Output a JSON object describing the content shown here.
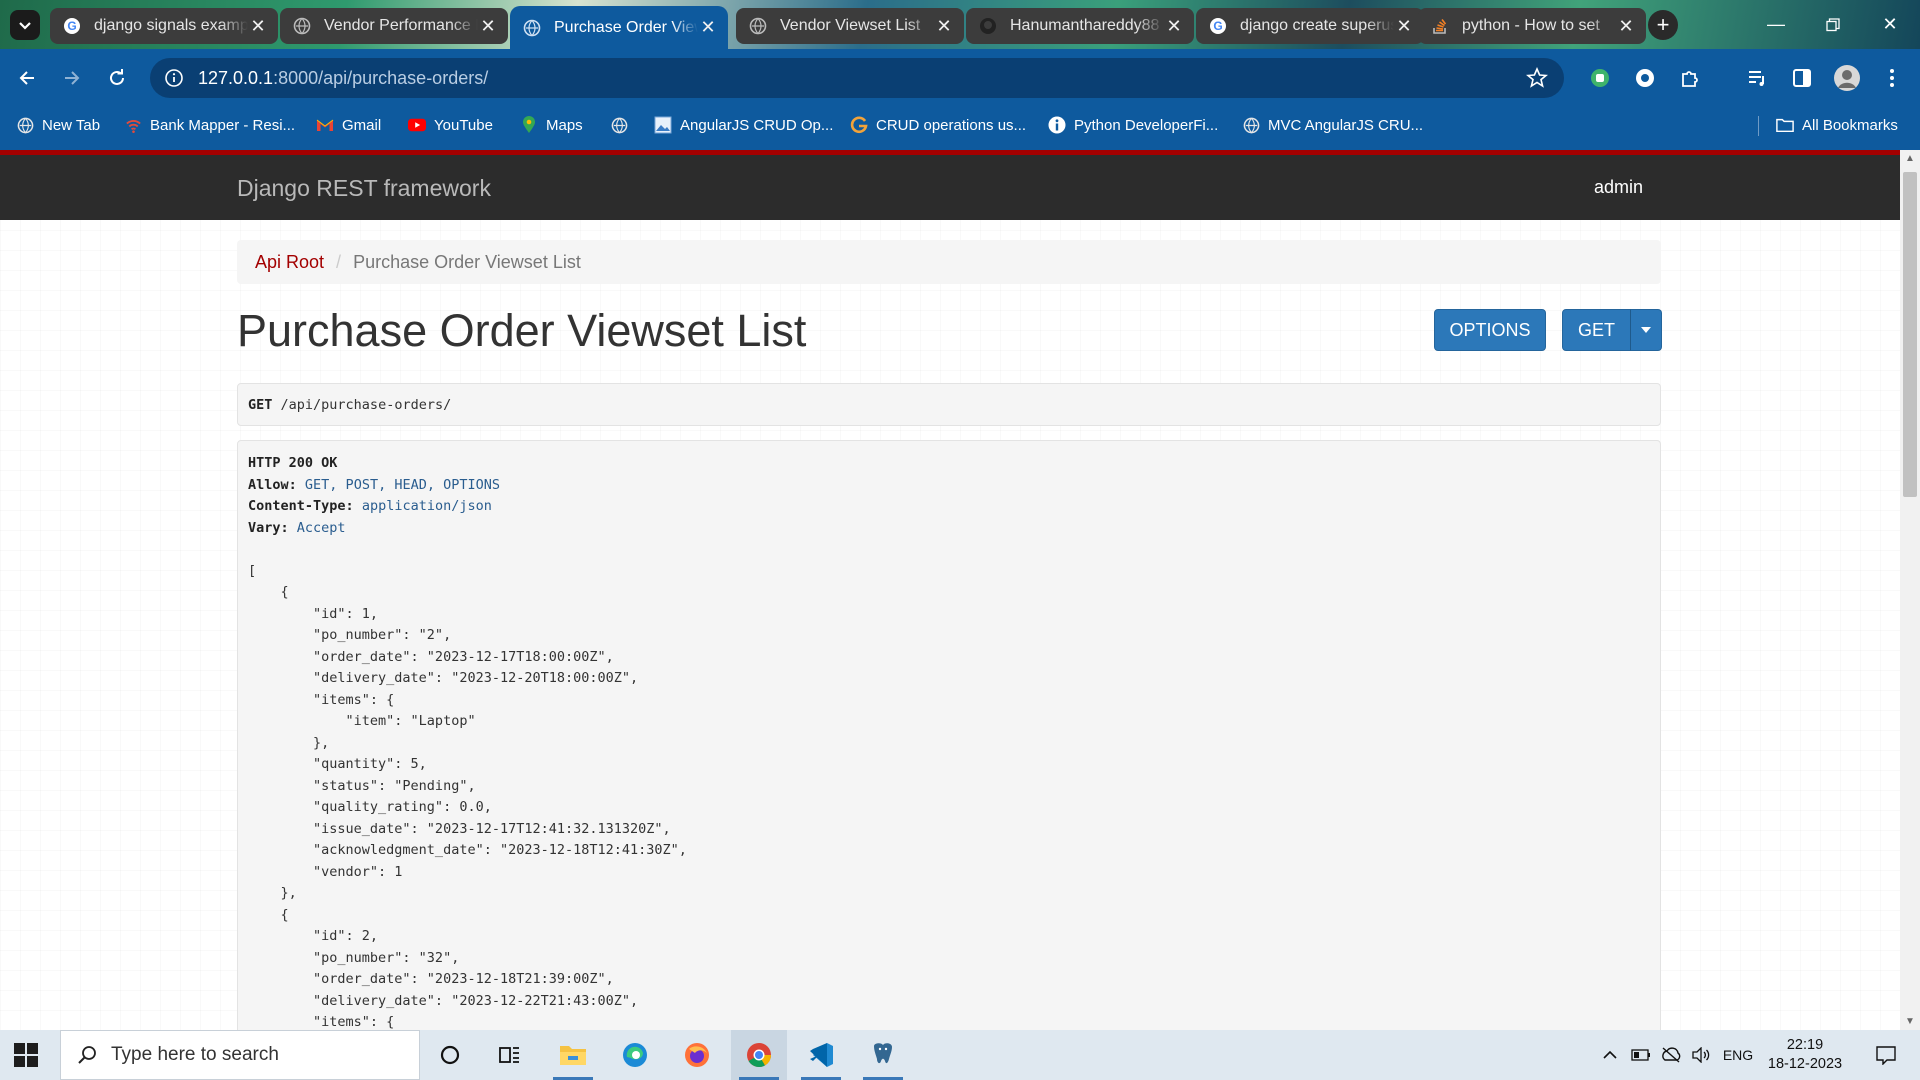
{
  "browser": {
    "tabs": [
      {
        "title": "django signals example",
        "icon": "google-icon",
        "active": false
      },
      {
        "title": "Vendor Performance Metrics",
        "icon": "globe-icon",
        "active": false
      },
      {
        "title": "Purchase Order Viewset List",
        "icon": "globe-icon",
        "active": true
      },
      {
        "title": "Vendor Viewset List",
        "icon": "globe-icon",
        "active": false
      },
      {
        "title": "Hanumanthareddy88",
        "icon": "github-icon",
        "active": false
      },
      {
        "title": "django create superuser",
        "icon": "google-icon",
        "active": false
      },
      {
        "title": "python - How to set",
        "icon": "stackoverflow-icon",
        "active": false
      }
    ],
    "url": {
      "host": "127.0.0.1",
      "path": ":8000/api/purchase-orders/"
    },
    "bookmarks": [
      {
        "label": "New Tab",
        "icon": "globe-icon"
      },
      {
        "label": "Bank Mapper - Resi...",
        "icon": "wifi-icon"
      },
      {
        "label": "Gmail",
        "icon": "gmail-icon"
      },
      {
        "label": "YouTube",
        "icon": "youtube-icon"
      },
      {
        "label": "Maps",
        "icon": "maps-icon"
      },
      {
        "label": "",
        "icon": "globe-icon"
      },
      {
        "label": "AngularJS CRUD Op...",
        "icon": "image-icon"
      },
      {
        "label": "CRUD operations us...",
        "icon": "g-icon"
      },
      {
        "label": "Python DeveloperFi...",
        "icon": "info-icon"
      },
      {
        "label": "MVC AngularJS CRU...",
        "icon": "globe-icon"
      }
    ],
    "all_bookmarks": "All Bookmarks"
  },
  "drf": {
    "brand": "Django REST framework",
    "user": "admin",
    "breadcrumb": {
      "root": "Api Root",
      "current": "Purchase Order Viewset List"
    },
    "title": "Purchase Order Viewset List",
    "buttons": {
      "options": "OPTIONS",
      "get": "GET"
    },
    "request": {
      "method": "GET",
      "path": "/api/purchase-orders/"
    },
    "response": {
      "status": "HTTP 200 OK",
      "headers": [
        {
          "name": "Allow:",
          "value": "GET, POST, HEAD, OPTIONS"
        },
        {
          "name": "Content-Type:",
          "value": "application/json"
        },
        {
          "name": "Vary:",
          "value": "Accept"
        }
      ],
      "body_lines": [
        "[",
        "    {",
        "        \"id\": 1,",
        "        \"po_number\": \"2\",",
        "        \"order_date\": \"2023-12-17T18:00:00Z\",",
        "        \"delivery_date\": \"2023-12-20T18:00:00Z\",",
        "        \"items\": {",
        "            \"item\": \"Laptop\"",
        "        },",
        "        \"quantity\": 5,",
        "        \"status\": \"Pending\",",
        "        \"quality_rating\": 0.0,",
        "        \"issue_date\": \"2023-12-17T12:41:32.131320Z\",",
        "        \"acknowledgment_date\": \"2023-12-18T12:41:30Z\",",
        "        \"vendor\": 1",
        "    },",
        "    {",
        "        \"id\": 2,",
        "        \"po_number\": \"32\",",
        "        \"order_date\": \"2023-12-18T21:39:00Z\",",
        "        \"delivery_date\": \"2023-12-22T21:43:00Z\",",
        "        \"items\": {"
      ]
    }
  },
  "taskbar": {
    "search_placeholder": "Type here to search",
    "language": "ENG",
    "time": "22:19",
    "date": "18-12-2023"
  },
  "colors": {
    "accent": "#0e5a9e",
    "drf_red": "#a30000",
    "button_blue": "#2c78b9"
  }
}
